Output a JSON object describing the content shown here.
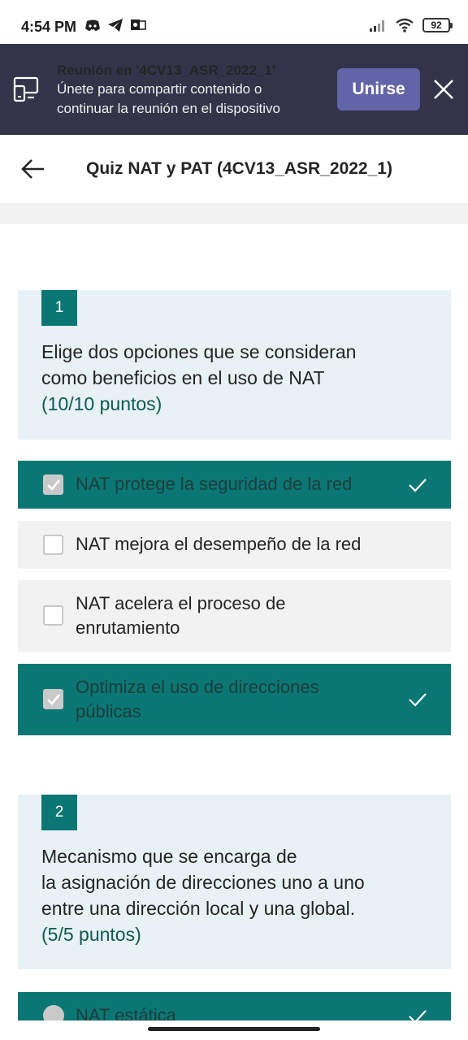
{
  "status_bar": {
    "time": "4:54 PM",
    "battery": "92",
    "left_icons": [
      "discord-icon",
      "telegram-icon",
      "outlook-icon"
    ],
    "right_icons": [
      "signal-icon",
      "wifi-icon",
      "battery-icon"
    ]
  },
  "meeting_banner": {
    "title": "Reunión en '4CV13_ASR_2022_1'",
    "subtitle_line1": "Únete para compartir contenido o",
    "subtitle_line2": "continuar la reunión en el dispositivo",
    "join_label": "Unirse",
    "background": "#33344a",
    "accent": "#6264a7"
  },
  "header": {
    "title": "Quiz NAT y PAT (4CV13_ASR_2022_1)"
  },
  "colors": {
    "correct_option": "#0a7774",
    "question_card": "#e8f1f5",
    "option_bg": "#f2f2f2"
  },
  "questions": [
    {
      "number": "1",
      "text_line1": "Elige dos opciones que se consideran",
      "text_line2": "como beneficios en el uso de NAT",
      "points": "(10/10 puntos)",
      "options": [
        {
          "label": "NAT protege la seguridad de la red",
          "selected": true,
          "correct": true
        },
        {
          "label": "NAT mejora el desempeño de la red",
          "selected": false,
          "correct": false
        },
        {
          "label_line1": "NAT acelera el proceso de",
          "label_line2": "enrutamiento",
          "selected": false,
          "correct": false
        },
        {
          "label_line1": "Optimiza el uso de direcciones",
          "label_line2": "públicas",
          "selected": true,
          "correct": true
        }
      ]
    },
    {
      "number": "2",
      "text_line1": "Mecanismo que se encarga de",
      "text_line2": "la asignación de direcciones uno a uno",
      "text_line3": "entre una dirección local y una global.",
      "points": "(5/5 puntos)",
      "options": [
        {
          "label": "NAT estática",
          "selected": true,
          "correct": true
        }
      ]
    }
  ]
}
